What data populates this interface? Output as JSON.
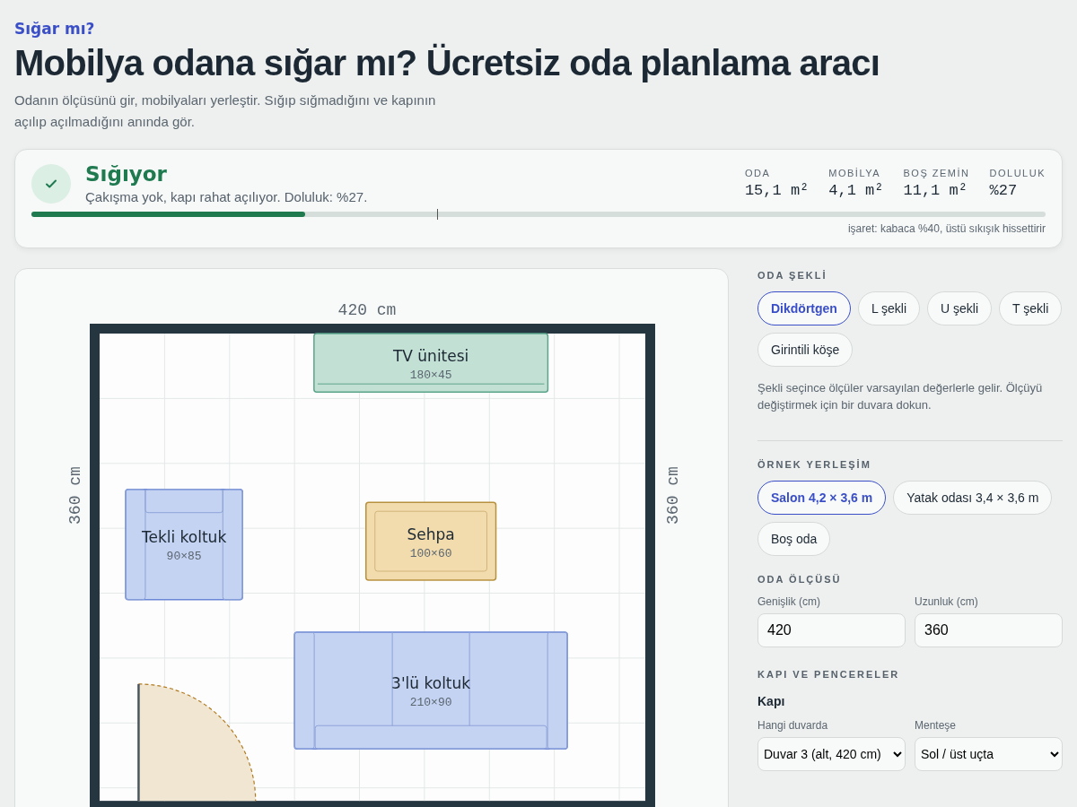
{
  "header": {
    "eyebrow": "Sığar mı?",
    "title": "Mobilya odana sığar mı? Ücretsiz oda planlama aracı",
    "description": "Odanın ölçüsünü gir, mobilyaları yerleştir. Sığıp sığmadığını ve kapının açılıp açılmadığını anında gör."
  },
  "status": {
    "kind": "ok",
    "title": "Sığıyor",
    "message": "Çakışma yok, kapı rahat açılıyor. Doluluk: %27.",
    "stats": [
      {
        "label": "ODA",
        "value": "15,1 m²"
      },
      {
        "label": "MOBİLYA",
        "value": "4,1 m²"
      },
      {
        "label": "BOŞ ZEMİN",
        "value": "11,1 m²"
      },
      {
        "label": "DOLULUK",
        "value": "%27"
      }
    ],
    "level": 0.27,
    "marker": {
      "level": 0.4
    },
    "note": "işaret: kabaca %40, üstü sıkışık hissettirir"
  },
  "plan": {
    "width_label": "420 cm",
    "left_label": "360 cm",
    "right_label": "360 cm",
    "furniture": [
      {
        "kind": "tv",
        "name": "TV ünitesi",
        "size": "180×45",
        "color": "#c3e0d5"
      },
      {
        "kind": "armchair",
        "name": "Tekli koltuk",
        "size": "90×85",
        "color": "#c5d3f3"
      },
      {
        "kind": "table",
        "name": "Sehpa",
        "size": "100×60",
        "color": "#f2dcae"
      },
      {
        "kind": "sofa",
        "name": "3'lü koltuk",
        "size": "210×90",
        "color": "#c5d3f3"
      }
    ]
  },
  "sidebar": {
    "shape": {
      "heading": "ODA ŞEKLİ",
      "options": [
        {
          "label": "Dikdörtgen",
          "selected": true
        },
        {
          "label": "L şekli",
          "selected": false
        },
        {
          "label": "U şekli",
          "selected": false
        },
        {
          "label": "T şekli",
          "selected": false
        },
        {
          "label": "Girintili köşe",
          "selected": false
        }
      ],
      "hint": "Şekli seçince ölçüler varsayılan değerlerle gelir. Ölçüyü değiştirmek için bir duvara dokun."
    },
    "presets": {
      "heading": "ÖRNEK YERLEŞİM",
      "options": [
        {
          "label": "Salon 4,2 × 3,6 m",
          "selected": true
        },
        {
          "label": "Yatak odası 3,4 × 3,6 m",
          "selected": false
        },
        {
          "label": "Boş oda",
          "selected": false
        }
      ]
    },
    "size": {
      "heading": "ODA ÖLÇÜSÜ",
      "fields": [
        {
          "label": "Genişlik (cm)",
          "value": "420"
        },
        {
          "label": "Uzunluk (cm)",
          "value": "360"
        }
      ]
    },
    "openings": {
      "heading": "KAPI VE PENCERELER",
      "door_title": "Kapı",
      "selects": [
        {
          "label": "Hangi duvarda",
          "value": "Duvar 3 (alt, 420 cm)"
        },
        {
          "label": "Menteşe",
          "value": "Sol / üst uçta"
        }
      ]
    }
  }
}
